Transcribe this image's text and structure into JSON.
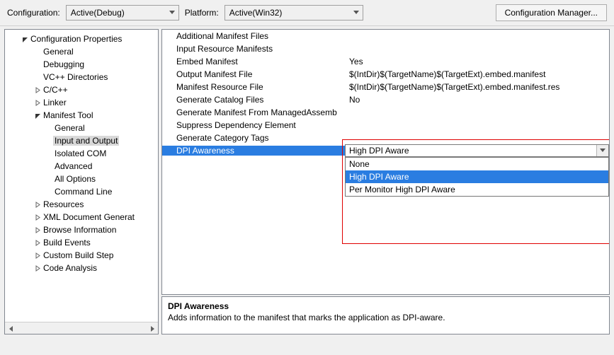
{
  "top": {
    "configLabel": "Configuration:",
    "configValue": "Active(Debug)",
    "platformLabel": "Platform:",
    "platformValue": "Active(Win32)",
    "managerBtn": "Configuration Manager..."
  },
  "tree": [
    {
      "lvl": 1,
      "tw": "down",
      "label": "Configuration Properties"
    },
    {
      "lvl": 2,
      "tw": "",
      "label": "General"
    },
    {
      "lvl": 2,
      "tw": "",
      "label": "Debugging"
    },
    {
      "lvl": 2,
      "tw": "",
      "label": "VC++ Directories"
    },
    {
      "lvl": 2,
      "tw": "right",
      "label": "C/C++"
    },
    {
      "lvl": 2,
      "tw": "right",
      "label": "Linker"
    },
    {
      "lvl": 2,
      "tw": "down",
      "label": "Manifest Tool"
    },
    {
      "lvl": 3,
      "tw": "",
      "label": "General"
    },
    {
      "lvl": 3,
      "tw": "",
      "label": "Input and Output",
      "selected": true
    },
    {
      "lvl": 3,
      "tw": "",
      "label": "Isolated COM"
    },
    {
      "lvl": 3,
      "tw": "",
      "label": "Advanced"
    },
    {
      "lvl": 3,
      "tw": "",
      "label": "All Options"
    },
    {
      "lvl": 3,
      "tw": "",
      "label": "Command Line"
    },
    {
      "lvl": 2,
      "tw": "right",
      "label": "Resources"
    },
    {
      "lvl": 2,
      "tw": "right",
      "label": "XML Document Generat"
    },
    {
      "lvl": 2,
      "tw": "right",
      "label": "Browse Information"
    },
    {
      "lvl": 2,
      "tw": "right",
      "label": "Build Events"
    },
    {
      "lvl": 2,
      "tw": "right",
      "label": "Custom Build Step"
    },
    {
      "lvl": 2,
      "tw": "right",
      "label": "Code Analysis"
    }
  ],
  "grid": [
    {
      "name": "Additional Manifest Files",
      "val": ""
    },
    {
      "name": "Input Resource Manifests",
      "val": ""
    },
    {
      "name": "Embed Manifest",
      "val": "Yes"
    },
    {
      "name": "Output Manifest File",
      "val": "$(IntDir)$(TargetName)$(TargetExt).embed.manifest"
    },
    {
      "name": "Manifest Resource File",
      "val": "$(IntDir)$(TargetName)$(TargetExt).embed.manifest.res"
    },
    {
      "name": "Generate Catalog Files",
      "val": "No"
    },
    {
      "name": "Generate Manifest From ManagedAssemb",
      "val": ""
    },
    {
      "name": "Suppress Dependency Element",
      "val": ""
    },
    {
      "name": "Generate Category Tags",
      "val": ""
    },
    {
      "name": "DPI Awareness",
      "val": "High DPI Aware",
      "sel": true
    }
  ],
  "dropdown": {
    "options": [
      "None",
      "High DPI Aware",
      "Per Monitor High DPI Aware"
    ],
    "highlighted": 1
  },
  "desc": {
    "title": "DPI Awareness",
    "body": "Adds information to the manifest that marks the application as DPI-aware."
  }
}
